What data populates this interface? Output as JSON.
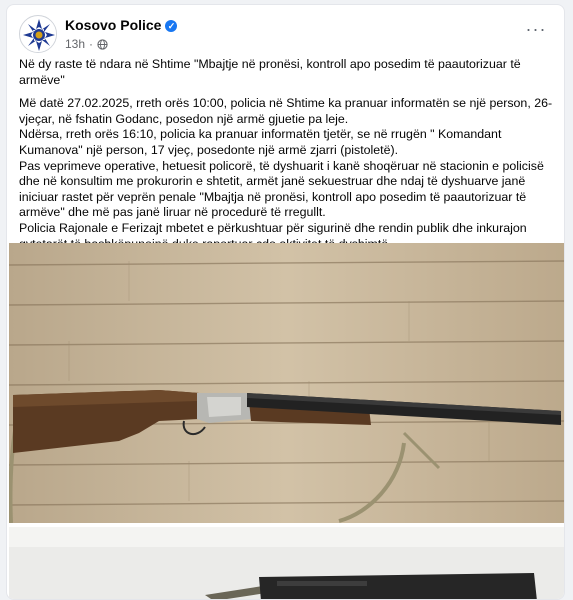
{
  "post": {
    "page_name": "Kosovo Police",
    "timestamp": "13h",
    "separator": "·",
    "more_label": "···",
    "headline": "Në dy raste të ndara në Shtime \"Mbajtje në pronësi, kontroll apo posedim të paautorizuar të armëve\"",
    "paragraphs": [
      "Më datë 27.02.2025, rreth orës 10:00, policia në Shtime ka pranuar informatën se një person, 26-vjeçar, në fshatin Godanc, posedon një armë gjuetie pa leje.",
      "Ndërsa, rreth orës 16:10, policia ka pranuar informatën tjetër, se në rrugën \" Komandant Kumanova\" një person, 17 vjeç, posedonte një armë zjarri (pistoletë).",
      "Pas veprimeve operative, hetuesit policorë, të dyshuarit i kanë shoqëruar në stacionin e policisë dhe në konsultim me prokurorin e shtetit, armët janë sekuestruar dhe ndaj të dyshuarve janë iniciuar rastet për veprën penale \"Mbajtja në pronësi, kontroll apo posedim të paautorizuar të armëve\" dhe më pas janë liruar në procedurë të rregullt.",
      "Policia Rajonale e Ferizajt mbetet e përkushtuar për sigurinë dhe rendin publik dhe inkurajon qytetarët të bashkëpunojnë duke raportuar çdo aktivitet të dyshimtë."
    ]
  },
  "icons": {
    "verified": "verified-badge-icon",
    "audience": "globe-icon",
    "more": "more-options-icon"
  },
  "colors": {
    "brand_blue": "#1877f2",
    "meta_gray": "#65676b",
    "wood_light": "#c9b79c",
    "wood_dark": "#8a7458"
  }
}
